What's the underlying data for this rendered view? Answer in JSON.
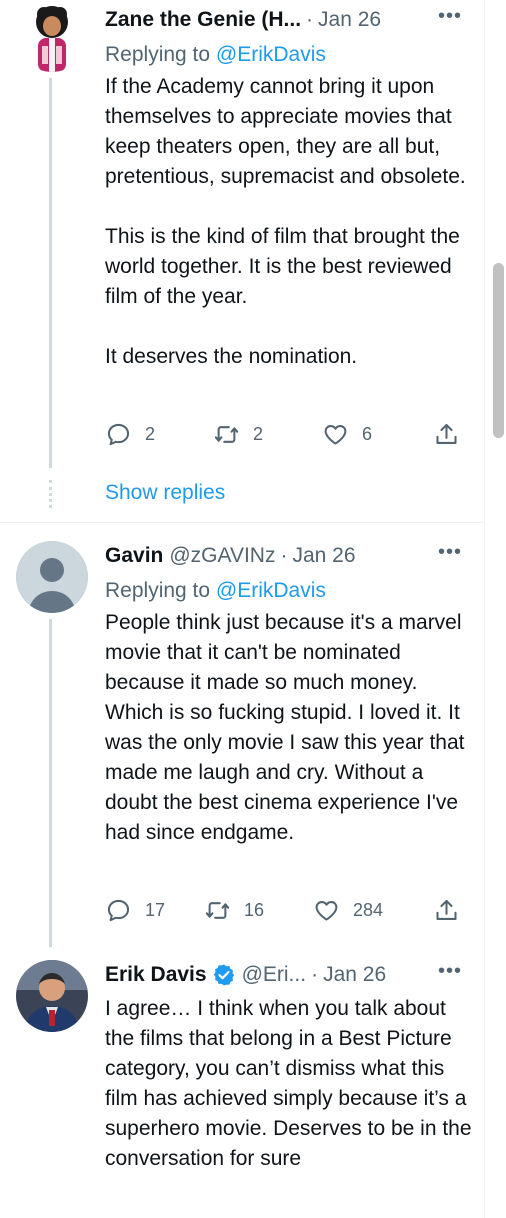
{
  "tweets": [
    {
      "name": "Zane the Genie (H...",
      "handle": "",
      "separator": "·",
      "date": "Jan 26",
      "more": "•••",
      "replying_to_label": "Replying to ",
      "replying_to_handle": "@ErikDavis",
      "paragraphs": [
        "If the Academy cannot bring it upon themselves to appreciate movies that keep theaters open, they are all but, pretentious, supremacist and obsolete.",
        "This is the kind of film that brought the world together. It is the best reviewed film of the year.",
        "It deserves the nomination."
      ],
      "replies": "2",
      "retweets": "2",
      "likes": "6",
      "show_replies": "Show replies"
    },
    {
      "name": "Gavin",
      "handle": "@zGAVINz",
      "separator": "·",
      "date": "Jan 26",
      "more": "•••",
      "replying_to_label": "Replying to ",
      "replying_to_handle": "@ErikDavis",
      "paragraphs": [
        "People think just because it's a marvel movie that it can't be nominated because it made so much money. Which is so fucking stupid. I loved it. It was the only movie I saw this year that made me laugh and cry. Without a doubt the best cinema experience I've had since endgame."
      ],
      "replies": "17",
      "retweets": "16",
      "likes": "284"
    },
    {
      "name": "Erik Davis",
      "handle": "@Eri...",
      "separator": "·",
      "date": "Jan 26",
      "more": "•••",
      "verified": true,
      "paragraphs": [
        "I agree… I think when you talk about the films that belong in a Best Picture category, you can’t dismiss what this film has achieved simply because it’s a superhero movie. Deserves to be in the conversation for sure"
      ]
    }
  ],
  "colors": {
    "text": "#0f1419",
    "secondary": "#536471",
    "link": "#1d9bf0",
    "thread_line": "#cfd9de",
    "scrollbar_thumb": "#c1c1c1"
  },
  "icons": {
    "reply": "reply-icon",
    "retweet": "retweet-icon",
    "like": "heart-icon",
    "share": "share-icon",
    "more": "more-icon",
    "verified": "verified-badge-icon"
  }
}
